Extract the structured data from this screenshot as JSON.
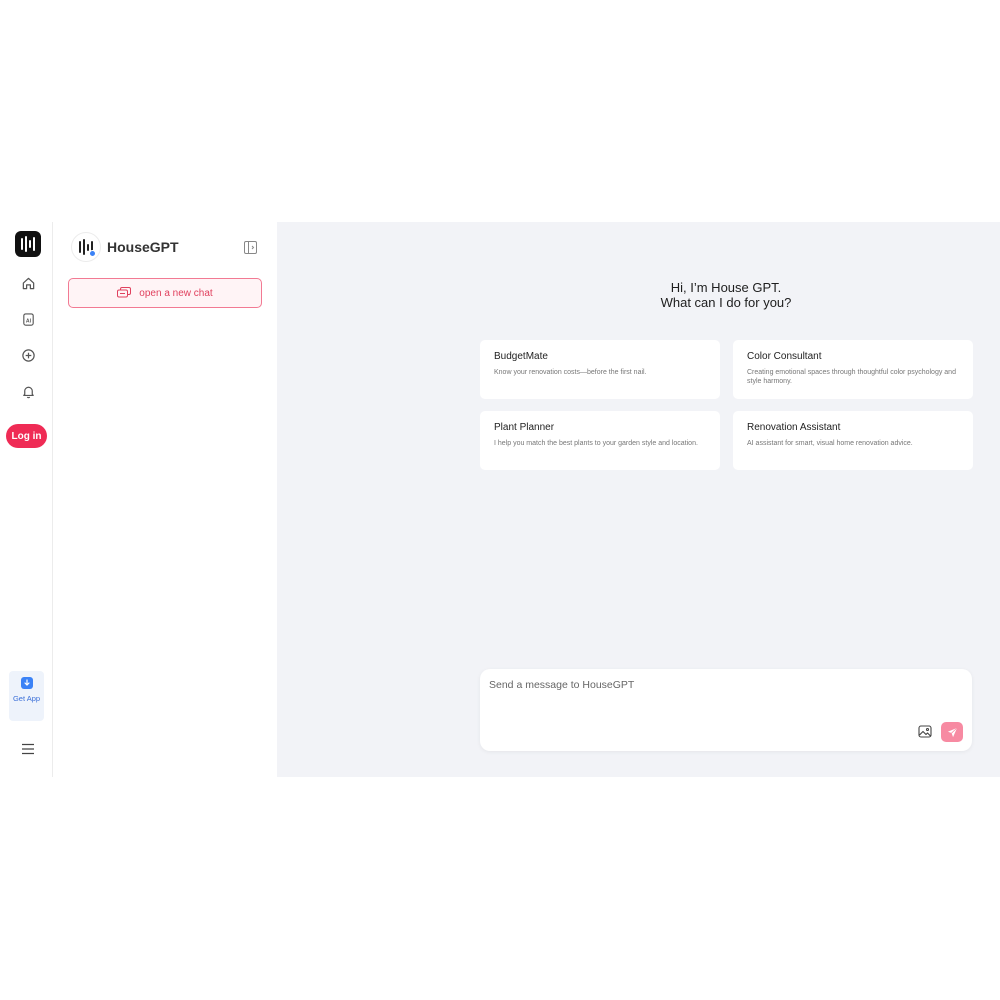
{
  "rail": {
    "logo_icon": "housegpt-logo",
    "items": [
      {
        "name": "home",
        "icon": "home-icon"
      },
      {
        "name": "ai",
        "icon": "ai-icon",
        "glyph": "AI"
      },
      {
        "name": "add",
        "icon": "plus-circle-icon"
      },
      {
        "name": "notifications",
        "icon": "bell-icon"
      }
    ],
    "login_label": "Log in",
    "get_app_label": "Get App",
    "menu_icon": "menu-icon"
  },
  "sidebar": {
    "brand_name": "HouseGPT",
    "new_chat_label": "open a new chat"
  },
  "main": {
    "greeting_line1": "Hi, I’m House GPT.",
    "greeting_line2": "What can I do for you?",
    "cards": [
      {
        "title": "BudgetMate",
        "desc": "Know your renovation costs—before the first nail."
      },
      {
        "title": "Color Consultant",
        "desc": "Creating emotional spaces through thoughtful color psychology and style harmony."
      },
      {
        "title": "Plant Planner",
        "desc": "I help you match the best plants to your garden style and location."
      },
      {
        "title": "Renovation Assistant",
        "desc": "AI assistant for smart, visual home renovation advice."
      }
    ],
    "composer": {
      "placeholder": "Send a message to HouseGPT",
      "value": ""
    }
  },
  "colors": {
    "accent": "#ef2b55",
    "main_bg": "#f2f3f7",
    "send_button": "#f78aa2",
    "app_blue": "#3b82f6"
  }
}
